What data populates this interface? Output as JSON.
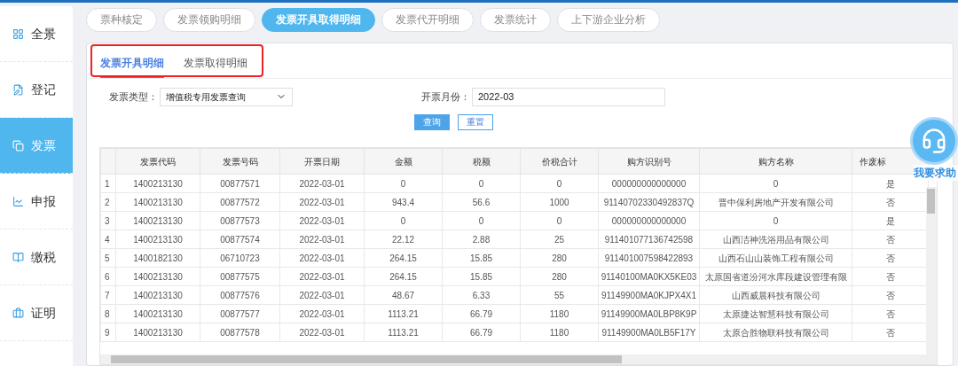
{
  "sidebar": {
    "items": [
      {
        "label": "全景",
        "selected": false
      },
      {
        "label": "登记",
        "selected": false
      },
      {
        "label": "发票",
        "selected": true
      },
      {
        "label": "申报",
        "selected": false
      },
      {
        "label": "缴税",
        "selected": false
      },
      {
        "label": "证明",
        "selected": false
      }
    ]
  },
  "top_tabs": [
    {
      "label": "票种核定",
      "selected": false
    },
    {
      "label": "发票领购明细",
      "selected": false
    },
    {
      "label": "发票开具取得明细",
      "selected": true
    },
    {
      "label": "发票代开明细",
      "selected": false
    },
    {
      "label": "发票统计",
      "selected": false
    },
    {
      "label": "上下游企业分析",
      "selected": false
    }
  ],
  "sub_tabs": [
    {
      "label": "发票开具明细",
      "selected": true
    },
    {
      "label": "发票取得明细",
      "selected": false
    }
  ],
  "filters": {
    "invoice_type": {
      "label": "发票类型：",
      "value": "增值税专用发票查询"
    },
    "month": {
      "label": "开票月份：",
      "value": "2022-03"
    }
  },
  "buttons": [
    "查询",
    "重置"
  ],
  "table": {
    "columns": [
      "发票代码",
      "发票号码",
      "开票日期",
      "金额",
      "税额",
      "价税合计",
      "购方识别号",
      "购方名称",
      "作废标"
    ],
    "rows": [
      {
        "index": "1",
        "cells": [
          "1400213130",
          "00877571",
          "2022-03-01",
          "0",
          "0",
          "0",
          "000000000000000",
          "0",
          "是"
        ]
      },
      {
        "index": "2",
        "cells": [
          "1400213130",
          "00877572",
          "2022-03-01",
          "943.4",
          "56.6",
          "1000",
          "91140702330492837Q",
          "晋中保利房地产开发有限公司",
          "否"
        ]
      },
      {
        "index": "3",
        "cells": [
          "1400213130",
          "00877573",
          "2022-03-01",
          "0",
          "0",
          "0",
          "000000000000000",
          "0",
          "是"
        ]
      },
      {
        "index": "4",
        "cells": [
          "1400213130",
          "00877574",
          "2022-03-01",
          "22.12",
          "2.88",
          "25",
          "911401077136742598",
          "山西洁神洗浴用品有限公司",
          "否"
        ]
      },
      {
        "index": "5",
        "cells": [
          "1400182130",
          "06710723",
          "2022-03-01",
          "264.15",
          "15.85",
          "280",
          "911401007598422893",
          "山西石山山装饰工程有限公司",
          "否"
        ]
      },
      {
        "index": "6",
        "cells": [
          "1400213130",
          "00877575",
          "2022-03-01",
          "264.15",
          "15.85",
          "280",
          "91140100MA0KX5KE03",
          "太原国省道汾河水库段建设管理有限",
          "否"
        ]
      },
      {
        "index": "7",
        "cells": [
          "1400213130",
          "00877576",
          "2022-03-01",
          "48.67",
          "6.33",
          "55",
          "91149900MA0KJPX4X1",
          "山西威晨科技有限公司",
          "否"
        ]
      },
      {
        "index": "8",
        "cells": [
          "1400213130",
          "00877577",
          "2022-03-01",
          "1113.21",
          "66.79",
          "1180",
          "91149900MA0LBP8K9P",
          "太原捷达智慧科技有限公司",
          "否"
        ]
      },
      {
        "index": "9",
        "cells": [
          "1400213130",
          "00877578",
          "2022-03-01",
          "1113.21",
          "66.79",
          "1180",
          "91149900MA0LB5F17Y",
          "太原合胜物联科技有限公司",
          "否"
        ]
      }
    ]
  },
  "help": {
    "label": "我要求助"
  }
}
